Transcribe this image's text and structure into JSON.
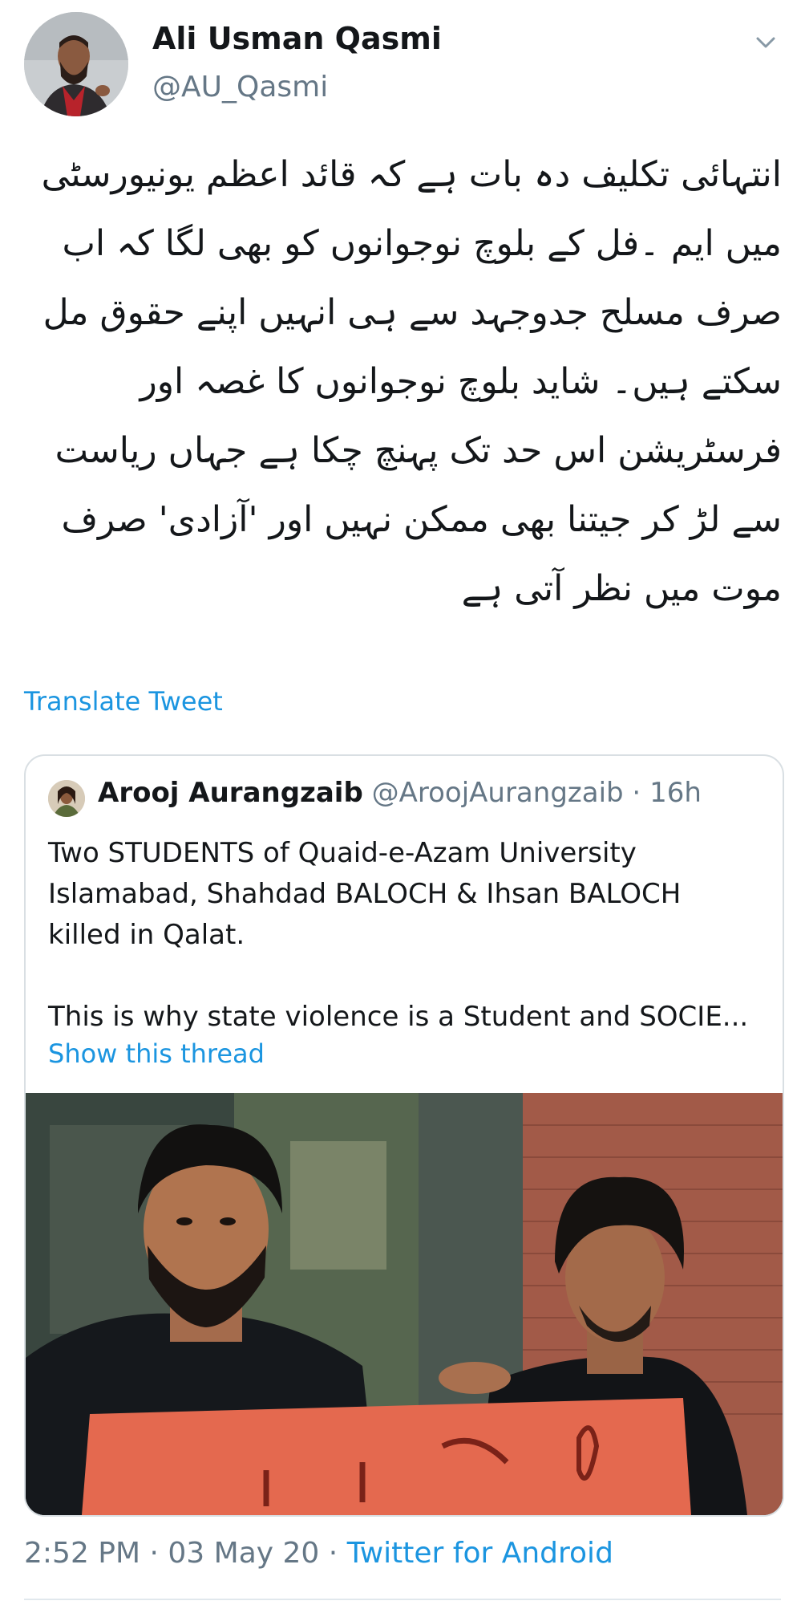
{
  "tweet": {
    "author": {
      "name": "Ali Usman Qasmi",
      "handle": "@AU_Qasmi"
    },
    "text": "انتہائی تکلیف دہ بات ہے کہ قائد اعظم یونیورسٹی میں ایم ۔فل کے بلوچ نوجوانوں کو بھی لگا کہ اب صرف مسلح جدوجہد سے ہی انہیں اپنے حقوق مل سکتے ہیں۔ شاید بلوچ نوجوانوں کا غصہ اور فرسٹریشن اس حد تک پہنچ چکا ہے جہاں ریاست سے لڑ کر جیتنا بھی ممکن نہیں اور 'آزادی' صرف موت میں نظر آتی ہے",
    "translate_label": "Translate Tweet",
    "time": "2:52 PM",
    "date": "03 May 20",
    "separator": " · ",
    "source": "Twitter for Android"
  },
  "quote": {
    "name": "Arooj Aurangzaib",
    "handle": "@AroojAurangzaib",
    "age": "16h",
    "meta_sep": " · ",
    "text_p1": "Two STUDENTS of Quaid-e-Azam University Islamabad, Shahdad BALOCH & Ihsan BALOCH killed in Qalat.",
    "text_p2": "This is why state violence is a Student and SOCIE...",
    "show_thread": "Show this thread"
  },
  "icons": {
    "caret": "chevron-down-icon"
  },
  "colors": {
    "link": "#1b95e0",
    "secondary": "#657786",
    "text": "#14171a",
    "border": "#d9dfe3"
  }
}
